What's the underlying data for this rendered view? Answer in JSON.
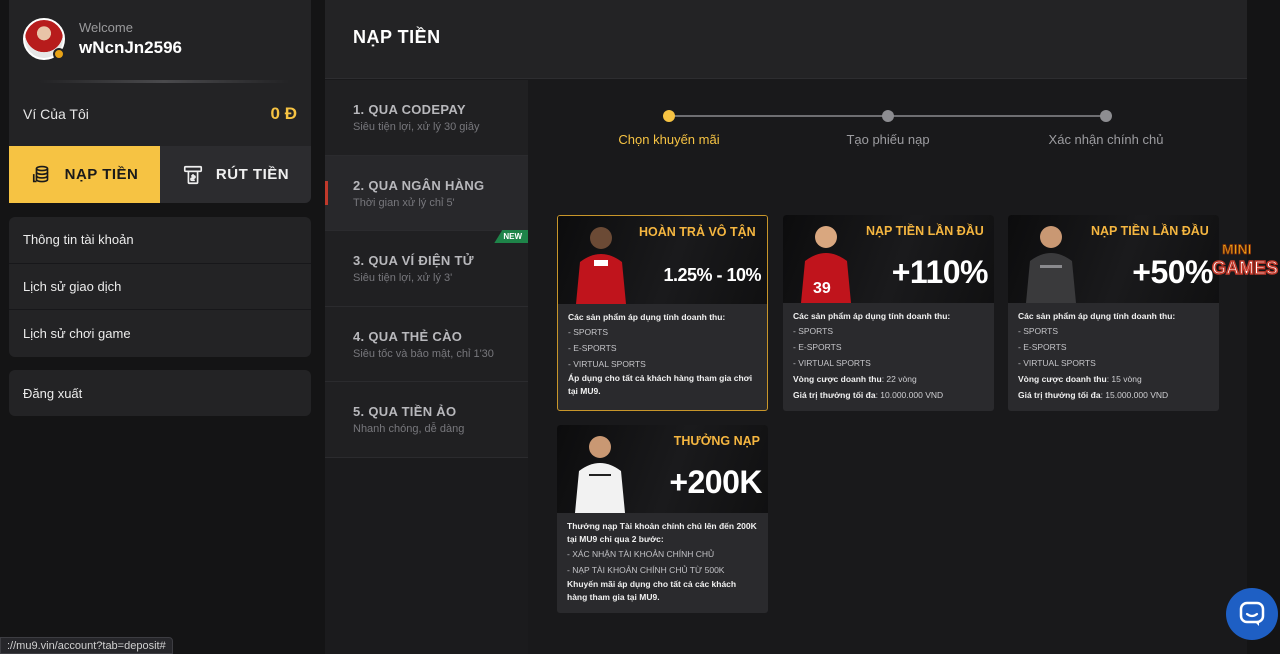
{
  "sidebar": {
    "welcome": "Welcome",
    "username": "wNcnJn2596",
    "wallet_label": "Ví Của Tôi",
    "wallet_value": "0 Đ",
    "deposit_tab": "NẠP TIỀN",
    "withdraw_tab": "RÚT TIỀN",
    "menu": [
      {
        "label": "Thông tin tài khoản"
      },
      {
        "label": "Lịch sử giao dịch"
      },
      {
        "label": "Lịch sử chơi game"
      }
    ],
    "logout": "Đăng xuất"
  },
  "status_url": "://mu9.vin/account?tab=deposit#",
  "main": {
    "title": "NẠP TIỀN",
    "methods": [
      {
        "title": "1. QUA CODEPAY",
        "subtitle": "Siêu tiện lợi, xử lý 30 giây"
      },
      {
        "title": "2. QUA NGÂN HÀNG",
        "subtitle": "Thời gian xử lý chỉ 5'"
      },
      {
        "title": "3. QUA VÍ ĐIỆN TỬ",
        "subtitle": "Siêu tiện lợi, xử lý 3'",
        "badge": "NEW"
      },
      {
        "title": "4. QUA THẺ CÀO",
        "subtitle": "Siêu tốc và bảo mật, chỉ 1'30"
      },
      {
        "title": "5. QUA TIỀN ẢO",
        "subtitle": "Nhanh chóng, dễ dàng"
      }
    ],
    "steps": [
      {
        "label": "Chọn khuyến mãi"
      },
      {
        "label": "Tạo phiếu nạp"
      },
      {
        "label": "Xác nhận chính chủ"
      }
    ],
    "promos": [
      {
        "title": "HOÀN TRẢ VÔ TẬN",
        "value": "1.25% - 10%",
        "heading": "Các sản phẩm áp dụng tính doanh thu:",
        "items": [
          "- SPORTS",
          "- E-SPORTS",
          "- VIRTUAL SPORTS"
        ],
        "note": "Áp dụng cho tất cả khách hàng tham gia chơi tại MU9."
      },
      {
        "title": "NẠP TIỀN LẦN ĐẦU",
        "value": "+110%",
        "heading": "Các sản phẩm áp dụng tính doanh thu:",
        "items": [
          "- SPORTS",
          "- E-SPORTS",
          "- VIRTUAL SPORTS"
        ],
        "wager_label": "Vòng cược doanh thu",
        "wager_value": ": 22 vòng",
        "max_label": "Giá trị thưởng tối đa",
        "max_value": ": 10.000.000 VND"
      },
      {
        "title": "NẠP TIỀN LẦN ĐẦU",
        "value": "+50%",
        "heading": "Các sản phẩm áp dụng tính doanh thu:",
        "items": [
          "- SPORTS",
          "- E-SPORTS",
          "- VIRTUAL SPORTS"
        ],
        "wager_label": "Vòng cược doanh thu",
        "wager_value": ": 15 vòng",
        "max_label": "Giá trị thưởng tối đa",
        "max_value": ": 15.000.000 VND"
      },
      {
        "title": "THƯỞNG NẠP",
        "value": "+200K",
        "heading": "Thưởng nạp Tài khoản chính chủ lên đến 200K tại MU9 chỉ qua 2 bước:",
        "items": [
          "- XÁC NHẬN TÀI KHOẢN CHÍNH CHỦ",
          "- NẠP TÀI KHOẢN CHÍNH CHỦ TỪ 500K"
        ],
        "note": "Khuyến mãi áp dụng cho tất cả các khách hàng tham gia tại MU9."
      }
    ]
  },
  "minigames_logo": "MINI GAMES",
  "colors": {
    "accent": "#f6c343",
    "panel": "#232325",
    "background": "#141415",
    "chat": "#1e5fc4"
  },
  "icons": {
    "deposit": "coins-icon",
    "withdraw": "cash-withdraw-icon",
    "chat": "chat-bubble-icon"
  }
}
